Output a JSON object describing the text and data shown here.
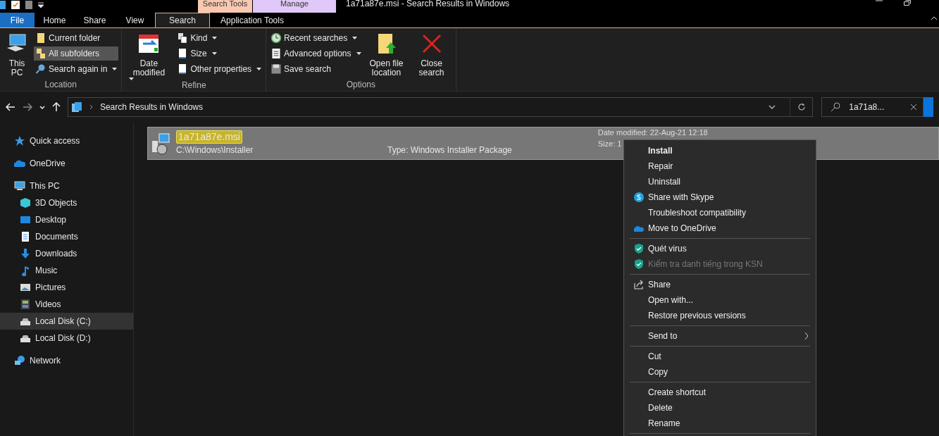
{
  "window": {
    "title": "1a71a87e.msi - Search Results in Windows"
  },
  "context_tabs": [
    {
      "label": "Search Tools",
      "color": "#f8c8b0"
    },
    {
      "label": "Manage",
      "color": "#e0c8f8"
    }
  ],
  "ribbon_tabs": [
    {
      "label": "File",
      "selected": false,
      "kind": "file"
    },
    {
      "label": "Home",
      "selected": false,
      "kind": "tab"
    },
    {
      "label": "Share",
      "selected": false,
      "kind": "tab"
    },
    {
      "label": "View",
      "selected": false,
      "kind": "tab"
    },
    {
      "label": "Search",
      "selected": true,
      "kind": "tab"
    },
    {
      "label": "Application Tools",
      "selected": false,
      "kind": "tab"
    }
  ],
  "ribbon_groups": [
    {
      "label": "Location",
      "items": [
        {
          "label": "This PC",
          "kind": "large",
          "dropdown": false,
          "selected": false
        },
        {
          "label": "Current folder",
          "kind": "small",
          "dropdown": false,
          "selected": false
        },
        {
          "label": "All subfolders",
          "kind": "small",
          "dropdown": false,
          "selected": true
        },
        {
          "label": "Search again in",
          "kind": "small",
          "dropdown": true,
          "selected": false
        }
      ]
    },
    {
      "label": "Refine",
      "items": [
        {
          "label": "Date modified",
          "kind": "large",
          "dropdown": true,
          "selected": false
        },
        {
          "label": "Kind",
          "kind": "small",
          "dropdown": true,
          "selected": false
        },
        {
          "label": "Size",
          "kind": "small",
          "dropdown": true,
          "selected": false
        },
        {
          "label": "Other properties",
          "kind": "small",
          "dropdown": true,
          "selected": false
        }
      ]
    },
    {
      "label": "Options",
      "items": [
        {
          "label": "Recent searches",
          "kind": "small",
          "dropdown": true,
          "selected": false
        },
        {
          "label": "Advanced options",
          "kind": "small",
          "dropdown": true,
          "selected": false
        },
        {
          "label": "Save search",
          "kind": "small",
          "dropdown": false,
          "selected": false
        },
        {
          "label": "Open file location",
          "kind": "large",
          "dropdown": false,
          "selected": false
        },
        {
          "label": "Close search",
          "kind": "large",
          "dropdown": false,
          "selected": false
        }
      ]
    }
  ],
  "address_bar": {
    "path": "Search Results in Windows"
  },
  "search": {
    "value": "1a71a8..."
  },
  "sidebar": {
    "items": [
      {
        "label": "Quick access",
        "selected": false
      },
      {
        "label": "OneDrive",
        "selected": false
      },
      {
        "label": "This PC",
        "selected": false,
        "children": [
          {
            "label": "3D Objects",
            "selected": false
          },
          {
            "label": "Desktop",
            "selected": false
          },
          {
            "label": "Documents",
            "selected": false
          },
          {
            "label": "Downloads",
            "selected": false
          },
          {
            "label": "Music",
            "selected": false
          },
          {
            "label": "Pictures",
            "selected": false
          },
          {
            "label": "Videos",
            "selected": false
          },
          {
            "label": "Local Disk (C:)",
            "selected": true
          },
          {
            "label": "Local Disk (D:)",
            "selected": false
          }
        ]
      },
      {
        "label": "Network",
        "selected": false
      }
    ]
  },
  "results": [
    {
      "name": "1a71a87e.msi",
      "path": "C:\\Windows\\Installer",
      "type": "Type: Windows Installer Package",
      "date": "Date modified: 22-Aug-21 12:18",
      "size": "Size: 1",
      "selected": true
    }
  ],
  "context_menu": {
    "groups": [
      [
        {
          "label": "Install",
          "default": true,
          "disabled": false,
          "submenu": false
        },
        {
          "label": "Repair",
          "default": false,
          "disabled": false,
          "submenu": false
        },
        {
          "label": "Uninstall",
          "default": false,
          "disabled": false,
          "submenu": false
        },
        {
          "label": "Share with Skype",
          "default": false,
          "disabled": false,
          "submenu": false
        },
        {
          "label": "Troubleshoot compatibility",
          "default": false,
          "disabled": false,
          "submenu": false
        },
        {
          "label": "Move to OneDrive",
          "default": false,
          "disabled": false,
          "submenu": false
        }
      ],
      [
        {
          "label": "Quét virus",
          "default": false,
          "disabled": false,
          "submenu": false
        },
        {
          "label": "Kiểm tra danh tiếng trong KSN",
          "default": false,
          "disabled": true,
          "submenu": false
        }
      ],
      [
        {
          "label": "Share",
          "default": false,
          "disabled": false,
          "submenu": false
        },
        {
          "label": "Open with...",
          "default": false,
          "disabled": false,
          "submenu": false
        },
        {
          "label": "Restore previous versions",
          "default": false,
          "disabled": false,
          "submenu": false
        }
      ],
      [
        {
          "label": "Send to",
          "default": false,
          "disabled": false,
          "submenu": true
        }
      ],
      [
        {
          "label": "Cut",
          "default": false,
          "disabled": false,
          "submenu": false
        },
        {
          "label": "Copy",
          "default": false,
          "disabled": false,
          "submenu": false
        }
      ],
      [
        {
          "label": "Create shortcut",
          "default": false,
          "disabled": false,
          "submenu": false
        },
        {
          "label": "Delete",
          "default": false,
          "disabled": false,
          "submenu": false
        },
        {
          "label": "Rename",
          "default": false,
          "disabled": false,
          "submenu": false
        }
      ]
    ]
  }
}
